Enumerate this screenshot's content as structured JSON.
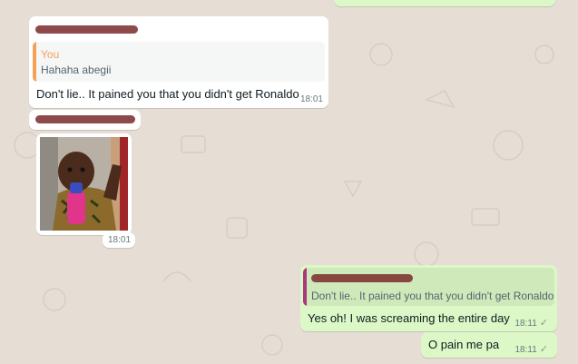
{
  "messages": {
    "m1": {
      "quote_author": "You",
      "quote_text": "Hahaha abegii",
      "text": "Don't lie..  It pained you that you didn't get Ronaldo",
      "time": "18:01"
    },
    "m2": {
      "time": "18:01"
    },
    "m3": {
      "quote_text": "Don't lie..  It pained you that you didn't get Ronaldo",
      "text": "Yes oh! I was screaming the entire day",
      "time": "18:11",
      "status_icon": "single-check-icon"
    },
    "m4": {
      "text": "O pain me pa",
      "time": "18:11",
      "status_icon": "single-check-icon"
    }
  },
  "tick_glyph": "✓",
  "colors": {
    "incoming": "#ffffff",
    "outgoing": "#dcf8c6",
    "you_quote_bar": "#f4a259",
    "other_quote_bar": "#a83a7c"
  }
}
